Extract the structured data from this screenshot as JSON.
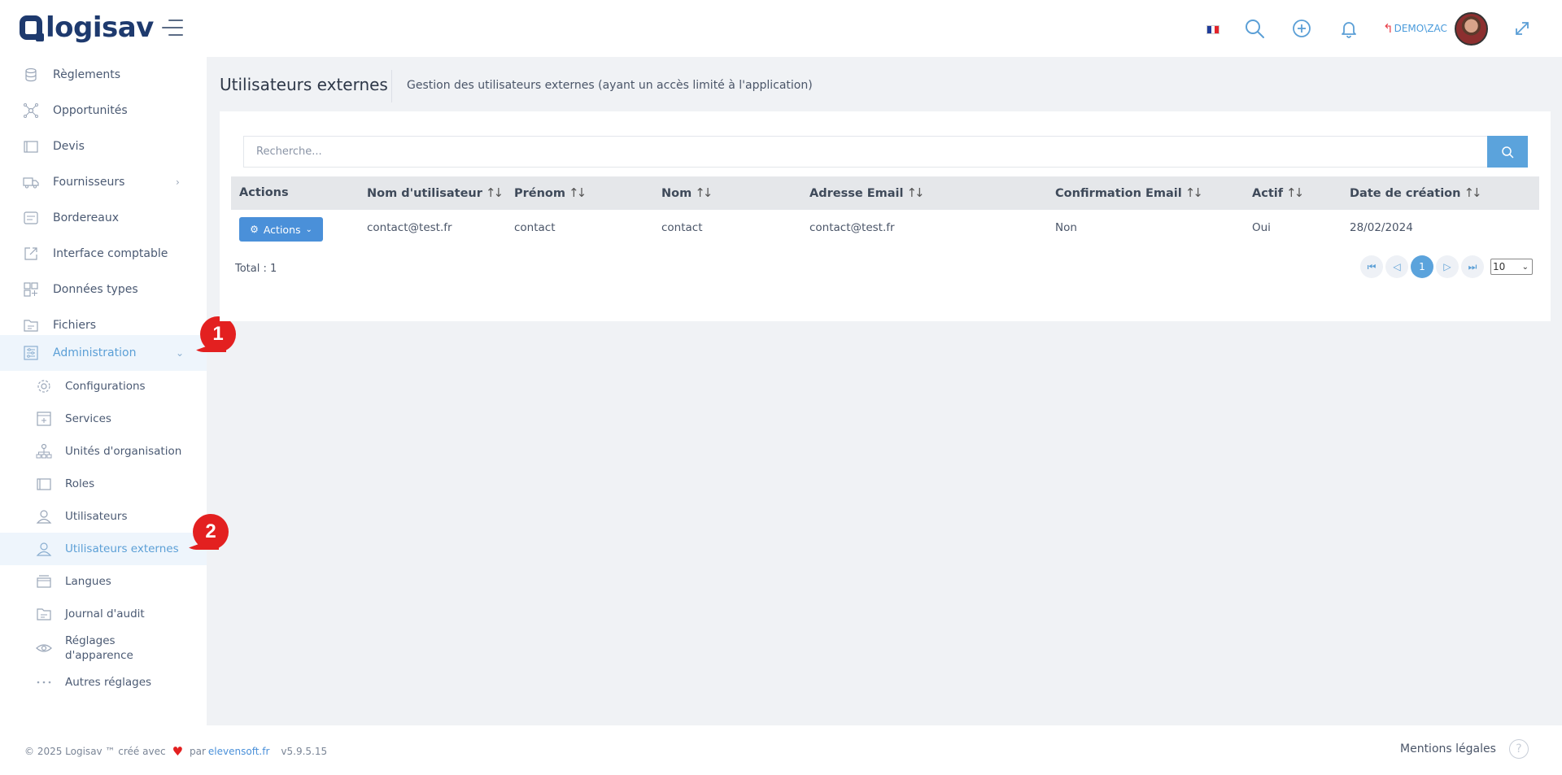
{
  "header": {
    "logo_text": "logisav",
    "switch_user": "DEMO\\ZAC",
    "flag_colors": [
      "#1f3c9b",
      "#ffffff",
      "#e3242b"
    ]
  },
  "sidebar": {
    "items": [
      {
        "label": "Règlements",
        "icon": "coins-icon"
      },
      {
        "label": "Opportunités",
        "icon": "network-icon"
      },
      {
        "label": "Devis",
        "icon": "folder-icon"
      },
      {
        "label": "Fournisseurs",
        "icon": "truck-icon",
        "has_children": true
      },
      {
        "label": "Bordereaux",
        "icon": "document-icon"
      },
      {
        "label": "Interface comptable",
        "icon": "external-link-icon"
      },
      {
        "label": "Données types",
        "icon": "grid-icon"
      },
      {
        "label": "Fichiers",
        "icon": "file-folder-icon"
      },
      {
        "label": "Administration",
        "icon": "admin-icon",
        "expanded": true,
        "active": true
      }
    ],
    "sub_items": [
      {
        "label": "Configurations",
        "icon": "gear-icon"
      },
      {
        "label": "Services",
        "icon": "add-box-icon"
      },
      {
        "label": "Unités d'organisation",
        "icon": "org-tree-icon"
      },
      {
        "label": "Roles",
        "icon": "folder-icon"
      },
      {
        "label": "Utilisateurs",
        "icon": "users-icon"
      },
      {
        "label": "Utilisateurs externes",
        "icon": "users-icon",
        "active": true
      },
      {
        "label": "Langues",
        "icon": "layers-icon"
      },
      {
        "label": "Journal d'audit",
        "icon": "file-folder-icon"
      },
      {
        "label": "Réglages d'apparence",
        "icon": "eye-icon"
      },
      {
        "label": "Autres réglages",
        "icon": "dots-icon"
      }
    ],
    "markers": [
      "1",
      "2"
    ]
  },
  "main": {
    "title": "Utilisateurs externes",
    "description": "Gestion des utilisateurs externes (ayant un accès limité à l'application)",
    "search_placeholder": "Recherche...",
    "columns": [
      "Actions",
      "Nom d'utilisateur",
      "Prénom",
      "Nom",
      "Adresse Email",
      "Confirmation Email",
      "Actif",
      "Date de création"
    ],
    "rows": [
      {
        "actions_label": "Actions",
        "username": "contact@test.fr",
        "firstname": "contact",
        "lastname": "contact",
        "email": "contact@test.fr",
        "email_confirmed": "Non",
        "active": "Oui",
        "created": "28/02/2024"
      }
    ],
    "total": "Total : 1",
    "current_page": "1",
    "page_size": "10"
  },
  "footer": {
    "copyright": "© 2025 Logisav ™ créé avec",
    "by": "par",
    "link": "elevensoft.fr",
    "version": "v5.9.5.15",
    "legal": "Mentions légales",
    "help": "?"
  },
  "colors": {
    "accent": "#5ba3dc",
    "marker": "#e32020",
    "logo": "#1e3a6e"
  }
}
